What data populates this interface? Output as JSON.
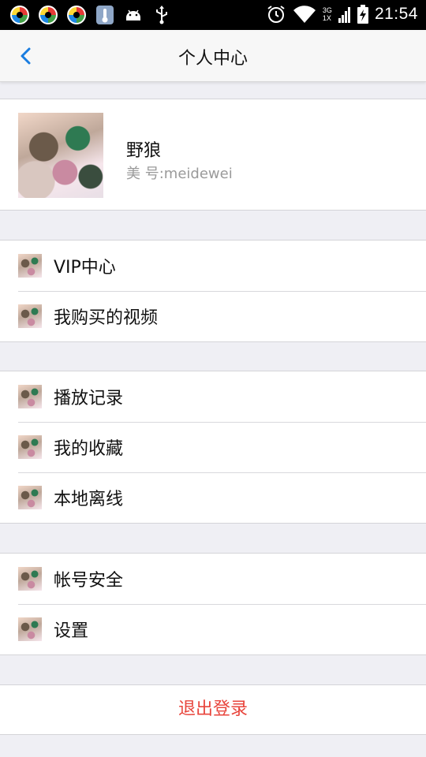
{
  "status_bar": {
    "time": "21:54",
    "network": "3G",
    "network_alt": "1X",
    "icons": [
      "app-icon",
      "app-icon",
      "app-icon",
      "thermometer-icon",
      "android-icon",
      "usb-icon",
      "alarm-icon",
      "wifi-icon",
      "signal-icon",
      "battery-charging-icon"
    ]
  },
  "nav": {
    "title": "个人中心",
    "back_icon": "chevron-left-icon"
  },
  "profile": {
    "name": "野狼",
    "id_text": "美 号:meidewei"
  },
  "groups": [
    {
      "items": [
        {
          "label": "VIP中心"
        },
        {
          "label": "我购买的视频"
        }
      ]
    },
    {
      "items": [
        {
          "label": "播放记录"
        },
        {
          "label": "我的收藏"
        },
        {
          "label": "本地离线"
        }
      ]
    },
    {
      "items": [
        {
          "label": "帐号安全"
        },
        {
          "label": "设置"
        }
      ]
    }
  ],
  "logout_label": "退出登录",
  "colors": {
    "accent": "#1a7de0",
    "logout": "#e8453c",
    "background": "#efeff4"
  }
}
